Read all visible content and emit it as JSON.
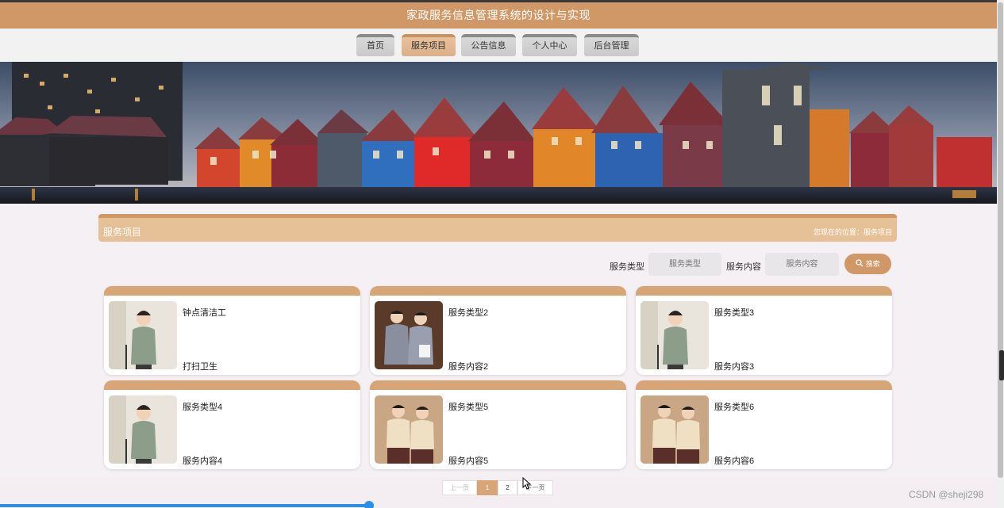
{
  "header": {
    "title": "家政服务信息管理系统的设计与实现"
  },
  "nav": {
    "items": [
      {
        "label": "首页",
        "active": false
      },
      {
        "label": "服务项目",
        "active": true
      },
      {
        "label": "公告信息",
        "active": false
      },
      {
        "label": "个人中心",
        "active": false
      },
      {
        "label": "后台管理",
        "active": false
      }
    ]
  },
  "section": {
    "title": "服务项目",
    "location": "您现在的位置：服务项目"
  },
  "filters": {
    "type_label": "服务类型",
    "type_placeholder": "服务类型",
    "content_label": "服务内容",
    "content_placeholder": "服务内容",
    "search_label": "搜索",
    "search_icon": "search-icon"
  },
  "cards": [
    {
      "type": "钟点清洁工",
      "content": "打扫卫生"
    },
    {
      "type": "服务类型2",
      "content": "服务内容2"
    },
    {
      "type": "服务类型3",
      "content": "服务内容3"
    },
    {
      "type": "服务类型4",
      "content": "服务内容4"
    },
    {
      "type": "服务类型5",
      "content": "服务内容5"
    },
    {
      "type": "服务类型6",
      "content": "服务内容6"
    }
  ],
  "pagination": {
    "prev": "上一页",
    "pages": [
      "1",
      "2"
    ],
    "current": "1",
    "next": "下一页"
  },
  "watermark": "CSDN @sheji298",
  "media_progress": 0.37,
  "colors": {
    "accent": "#cf9866",
    "accent_light": "#e6c197",
    "progress": "#2b8fe8"
  }
}
